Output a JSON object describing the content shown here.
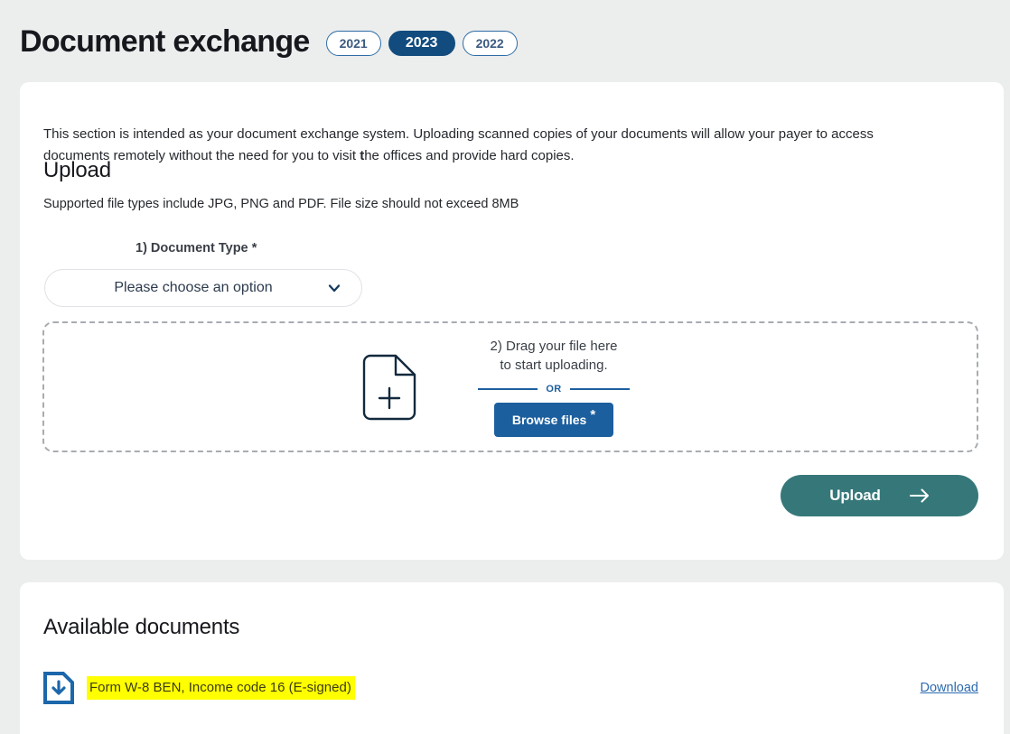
{
  "header": {
    "title": "Document exchange",
    "year_pills": [
      {
        "label": "2021",
        "active": false
      },
      {
        "label": "2023",
        "active": true
      },
      {
        "label": "2022",
        "active": false
      }
    ]
  },
  "upload_card": {
    "intro_part1": "This section is intended as your document exchange system. Uploading scanned copies of your documents will allow your payer to access documents remotely without the need for you to visit ",
    "intro_bold": "t",
    "intro_part2": "he offices and provide hard copies.",
    "heading": "Upload",
    "supported_note": "Supported file types include JPG, PNG and PDF. File size should not exceed 8MB",
    "document_type": {
      "label": "1) Document Type",
      "required_mark": "*",
      "selected_value": "Please choose an option",
      "chevron_icon": "chevron-down-icon"
    },
    "dropzone": {
      "file_icon": "file-plus-icon",
      "instruction_line1": "2) Drag your file here",
      "instruction_line2": "to start uploading.",
      "or_label": "OR",
      "browse_label": "Browse files",
      "browse_required_mark": "*"
    },
    "upload_button": {
      "label": "Upload",
      "arrow_icon": "arrow-right-icon"
    }
  },
  "documents_card": {
    "heading": "Available documents",
    "rows": [
      {
        "icon": "document-download-icon",
        "name": "Form W-8 BEN, Income code 16 (E-signed)",
        "download_label": "Download",
        "highlighted": true
      }
    ]
  },
  "colors": {
    "page_background": "#eceded",
    "card_background": "#ffffff",
    "pill_active_background": "#124c7f",
    "pill_border": "#2d6ca6",
    "browse_button": "#1c5f9e",
    "upload_button": "#36787a",
    "link_blue": "#2c6bb0",
    "highlight_yellow": "#ffff00",
    "dashed_border": "#a8acb1"
  }
}
